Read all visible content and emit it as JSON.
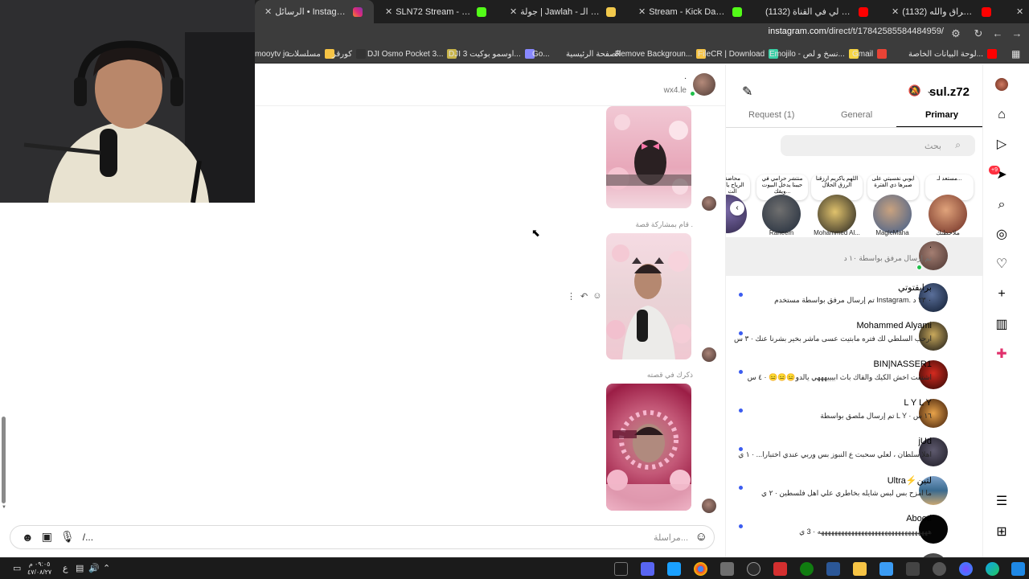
{
  "browser": {
    "tabs": [
      {
        "title": "الرسائل • Instagram (9)",
        "active": true
      },
      {
        "title": "SLN72 Stream - Watch Live on",
        "active": false
      },
      {
        "title": "جولة | Jawlah - منصة الألعاب الـ",
        "active": false
      },
      {
        "title": "Stream - Kick Dashboard",
        "active": false
      },
      {
        "title": "(1132) اول مقطع لي في القناة",
        "active": false
      },
      {
        "title": "(1132) من يحونك يا عراق والله",
        "active": false
      }
    ],
    "url_host": "instagram.com",
    "url_path": "/direct/t/17842585584484959/",
    "bookmarks": [
      "mooytv jo...",
      "مسلسلات",
      "كورقر",
      "DJI Osmo Pocket 3...",
      "DJI اوسمو بوكيت 3...",
      "Go...",
      "الصفحة الرئيسية",
      "Remove Backgroun...",
      "FileCR | Download",
      "Emojilo - نسخ و لص...",
      "Gmail",
      "لوحة البيانات الخاصة..."
    ]
  },
  "chat": {
    "header_name": "wx4.le",
    "header_dot": ".",
    "captions": [
      "قام بمشاركة قصة .",
      "ذكرك في قصته"
    ],
    "composer_placeholder": "مراسلة...",
    "composer_gif": "/..."
  },
  "inbox": {
    "username": "sul.z72",
    "tabs": [
      "Primary",
      "General",
      "Request (1)"
    ],
    "search_placeholder": "بحث",
    "notes": [
      {
        "bubble": "مستعد لـ...",
        "label": "ملاحظتك"
      },
      {
        "bubble": "ايوبي نفسيتي على صبرها ذي الفترة",
        "label": "MagicMaha"
      },
      {
        "bubble": "اللهم ياكريم ارزقنا الرزق الحلال",
        "label": "Mohammed Al..."
      },
      {
        "bubble": "منتشر حرامي في حيبنا يدخل البيوت ويقك...",
        "label": "Raneem"
      },
      {
        "bubble": "محاضة الرياح ياكو الت",
        "label": ""
      }
    ],
    "conversations": [
      {
        "name": ".",
        "preview": "تم إرسال مرفق بواسطة ١٠ د",
        "selected": true,
        "unread": false,
        "online": true
      },
      {
        "name": "برايقتوتي",
        "preview": "تم إرسال مرفق بواسطة مستخدم Instagram. ٠ ٢٣ د",
        "selected": false,
        "unread": true,
        "online": false
      },
      {
        "name": "Mohammed Alyami",
        "preview": "ارحب السلطي لك فتره مابتيت عسى ماشر بخير بشرنا عنك · ٣ س",
        "selected": false,
        "unread": true,
        "online": false
      },
      {
        "name": "BIN|NASSER1",
        "preview": "اشتقت اخش الكيك والقاك باث ابيييهههي يالدو😑😑😑 · ٤ س",
        "selected": false,
        "unread": true,
        "online": false
      },
      {
        "name": "L Y L Y",
        "preview": "تم إرسال ملصق بواسطة L Y · ١٦ س",
        "selected": false,
        "unread": true,
        "online": false
      },
      {
        "name": "jUd",
        "preview": "اهلا سلطان ، لعلي سحبت ع النبوز بس وربي عندي اختبارا... · ١ ي",
        "selected": false,
        "unread": true,
        "online": false
      },
      {
        "name": "Ultra⚡لتين",
        "preview": "ما امزح بس لبس شايله بخاطري علي اهل فلسطين · ٢ ي",
        "selected": false,
        "unread": true,
        "online": false
      },
      {
        "name": "Abood",
        "preview": "هههههههههههههههههههههههههههههههههه · 3 ي",
        "selected": false,
        "unread": true,
        "online": false
      }
    ]
  },
  "rail": {
    "badge": "+9",
    "icons": [
      "avatar",
      "home-icon",
      "reels-icon",
      "messenger-icon",
      "search-icon",
      "explore-icon",
      "heart-icon",
      "create-icon",
      "dashboard-icon",
      "threads-icon",
      "menu-icon",
      "apps-icon"
    ]
  },
  "taskbar": {
    "time": "٠٩:٠٥ م",
    "date": "٤٧/٠٨/٢٧",
    "lang": "ع"
  }
}
